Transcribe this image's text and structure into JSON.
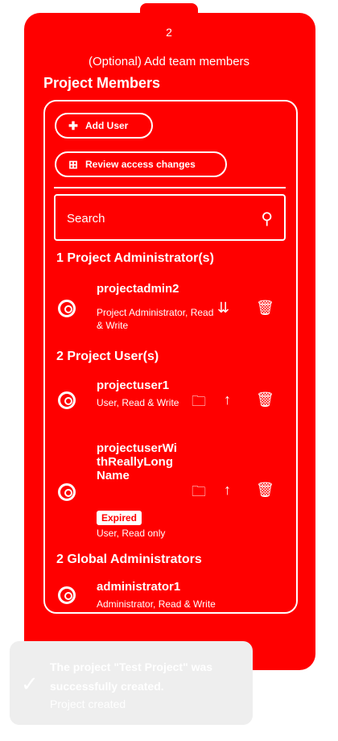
{
  "stepper": {
    "number": "2",
    "title": "(Optional) Add team members"
  },
  "section_title": "Project Members",
  "actions": {
    "add_user": "Add User",
    "review_access": "Review access changes"
  },
  "search": {
    "label": "Search"
  },
  "groups": {
    "admins": "1 Project Administrator(s)",
    "users": "2 Project User(s)",
    "global": "2 Global Administrators"
  },
  "members": {
    "admin1": {
      "name": "projectadmin2",
      "role": "Project Administrator, Read & Write"
    },
    "user1": {
      "name": "projectuser1",
      "role": "User, Read & Write"
    },
    "user2": {
      "name": "projectuserWithReallyLongName",
      "role": "User, Read only",
      "badge": "Expired"
    },
    "global1": {
      "name": "administrator1",
      "role": "Administrator, Read & Write"
    }
  },
  "toast": {
    "message": "The project \"Test Project\" was successfully created.",
    "title": "Project created"
  },
  "colors": {
    "panel": "#ff0000",
    "foreground": "#ffffff",
    "toast_bg": "#eeeeee"
  },
  "icons": [
    "search-icon",
    "add-user-icon",
    "review-icon",
    "folder-icon",
    "arrow-up-icon",
    "trash-icon",
    "check-icon",
    "avatar-icon"
  ]
}
